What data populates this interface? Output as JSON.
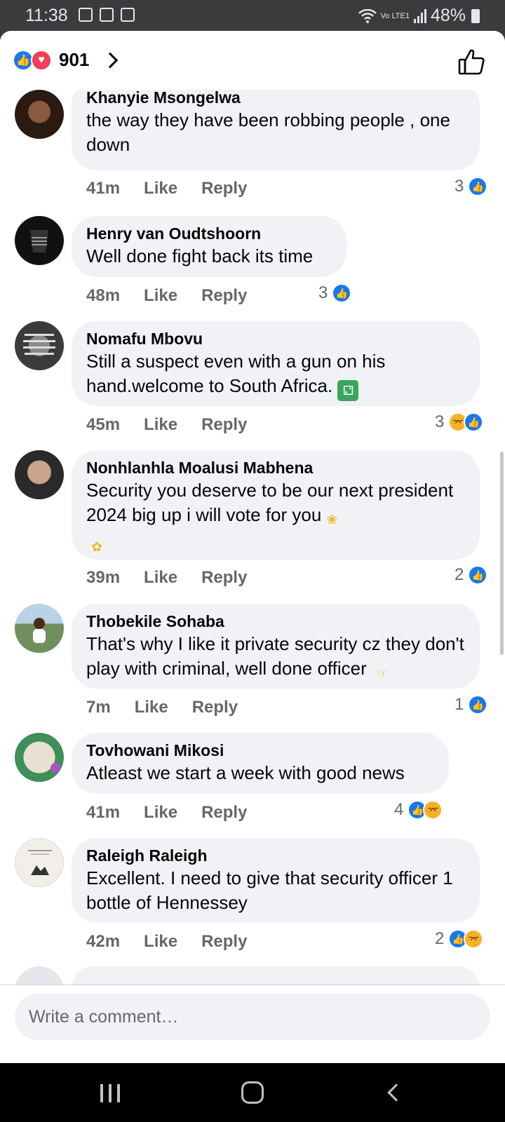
{
  "status_bar": {
    "time": "11:38",
    "network": "Vo LTE1",
    "battery": "48%"
  },
  "header": {
    "reaction_count": "901"
  },
  "comments": [
    {
      "author": "Khanyie Msongelwa",
      "text": "the way they have been robbing people , one down",
      "time": "41m",
      "like": "Like",
      "reply": "Reply",
      "reaction_count": "3",
      "reactions": [
        "like"
      ]
    },
    {
      "author": "Henry van Oudtshoorn",
      "text": "Well done fight back its time",
      "time": "48m",
      "like": "Like",
      "reply": "Reply",
      "reaction_count": "3",
      "reactions": [
        "like"
      ]
    },
    {
      "author": "Nomafu Mbovu",
      "text": "Still a suspect even with a gun on his hand.welcome to South Africa.",
      "time": "45m",
      "like": "Like",
      "reply": "Reply",
      "reaction_count": "3",
      "reactions": [
        "haha",
        "like"
      ]
    },
    {
      "author": "Nonhlanhla Moalusi Mabhena",
      "text": "Security you deserve to be our next president 2024 big up i will vote for you",
      "time": "39m",
      "like": "Like",
      "reply": "Reply",
      "reaction_count": "2",
      "reactions": [
        "like"
      ]
    },
    {
      "author": "Thobekile Sohaba",
      "text": "That's why I like it private security cz they don't play with criminal, well done officer",
      "time": "7m",
      "like": "Like",
      "reply": "Reply",
      "reaction_count": "1",
      "reactions": [
        "like"
      ]
    },
    {
      "author": "Tovhowani Mikosi",
      "text": "Atleast we start a week with good news",
      "time": "41m",
      "like": "Like",
      "reply": "Reply",
      "reaction_count": "4",
      "reactions": [
        "like",
        "haha"
      ]
    },
    {
      "author": "Raleigh Raleigh",
      "text": "Excellent.  I need to give that security officer 1 bottle of Hennessey",
      "time": "42m",
      "like": "Like",
      "reply": "Reply",
      "reaction_count": "2",
      "reactions": [
        "like",
        "haha"
      ]
    }
  ],
  "composer": {
    "placeholder": "Write a comment…"
  },
  "colors": {
    "accent": "#1877f2",
    "love": "#f33e58",
    "haha": "#f7b125",
    "bubble": "#f0f2f5",
    "muted": "#65676b"
  }
}
